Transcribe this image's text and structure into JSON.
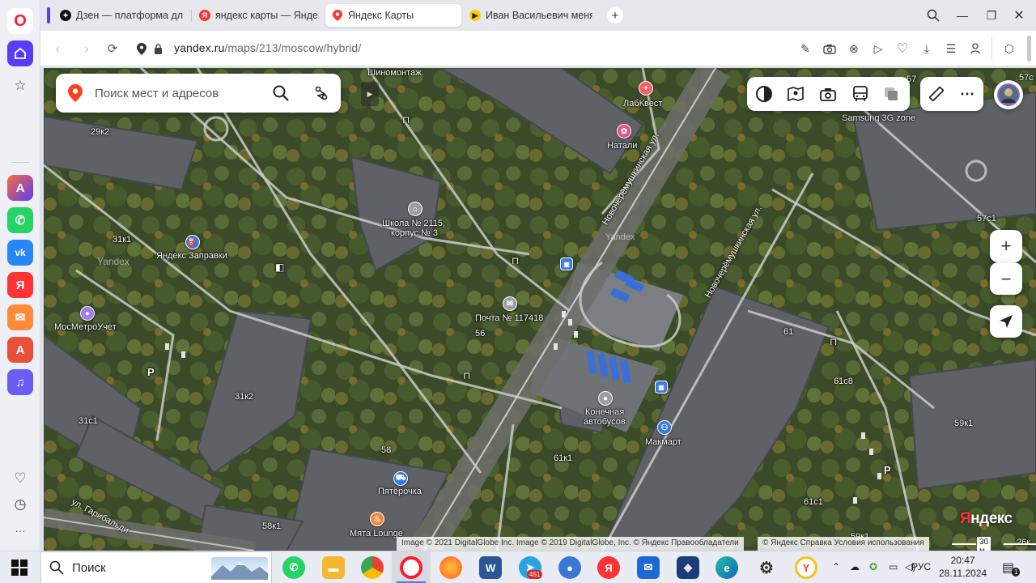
{
  "sidebar": {
    "logo": "O",
    "items": [
      {
        "name": "home-icon",
        "glyph": "⌂"
      },
      {
        "name": "star-icon",
        "glyph": "☆"
      },
      {
        "name": "aria-icon",
        "glyph": "A"
      },
      {
        "name": "whatsapp-icon",
        "glyph": "✆"
      },
      {
        "name": "vk-icon",
        "glyph": "vk"
      },
      {
        "name": "yandex-icon",
        "glyph": "Я"
      },
      {
        "name": "mail-icon",
        "glyph": "✉"
      },
      {
        "name": "translate-icon",
        "glyph": "A"
      },
      {
        "name": "music-icon",
        "glyph": "♫"
      },
      {
        "name": "heart-icon",
        "glyph": "♡"
      },
      {
        "name": "history-icon",
        "glyph": "◷"
      },
      {
        "name": "more-icon",
        "glyph": "···"
      }
    ]
  },
  "tabs": [
    {
      "title": "Дзен — платформа для п",
      "active": false
    },
    {
      "title": "яндекс карты — Яндекс.",
      "active": false
    },
    {
      "title": "Яндекс Карты",
      "active": true
    },
    {
      "title": "Иван Васильевич меняет",
      "active": false
    }
  ],
  "address": {
    "host": "yandex.ru",
    "path": "/maps/213/moscow/hybrid/"
  },
  "search": {
    "placeholder": "Поиск мест и адресов"
  },
  "map_labels": {
    "shinomontazh": "Шиномонтаж",
    "labkvest": "ЛабКвест",
    "natali": "Натали",
    "samsung": "Samsung 3G zone",
    "b57": "57",
    "b57c1": "57с1",
    "b57c_edge": "57с",
    "b29k2": "29к2",
    "school": "Школа № 2115,",
    "school2": "корпус № 3",
    "b31k1": "31к1",
    "zapravki": "Яндекс Заправки",
    "mosmetro": "МосМетроУчет",
    "pochta": "Почта № 117418",
    "b56": "56",
    "b61": "61",
    "b61c8": "61с8",
    "b31k2": "31к2",
    "b31c1": "31с1",
    "konechnaya": "Конечная",
    "konechnaya2": "автобусов",
    "makmart": "Макмарт",
    "b59k1": "59к1",
    "b58": "58",
    "b61k1": "61к1",
    "pyaterochka": "Пятёрочка",
    "b61c1": "61с1",
    "b58k1": "58к1",
    "myata": "Мята Lounge",
    "garibaldi": "ул. Гарибальди",
    "novo1": "Новочерёмушкинская ул.",
    "novo2": "Новочерёмушкинская ул.",
    "b59k1_bottom": "59к1",
    "b26k": "26к",
    "watermark1": "Yandex",
    "watermark2": "Yandex",
    "parking": "P"
  },
  "copyright": {
    "imagery": "Image © 2021 DigitalGlobe Inc. Image © 2019 DigitalGlobe, Inc. © Яндекс  Правообладатели",
    "terms": "© Яндекс  Справка  Условия использования",
    "scale": "30 м"
  },
  "logo": {
    "prefix": "Я",
    "rest": "ндекс"
  },
  "zoom": {
    "in": "+",
    "out": "−"
  },
  "taskbar": {
    "search": "Поиск",
    "lang": "РУС",
    "time": "20:47",
    "date": "28.11.2024",
    "telegram_badge": "451",
    "notif_badge": "1"
  },
  "colors": {
    "accent_purple": "#5b3cf5",
    "yandex_red": "#fc3f1d",
    "opera_red": "#ff1b2d"
  }
}
